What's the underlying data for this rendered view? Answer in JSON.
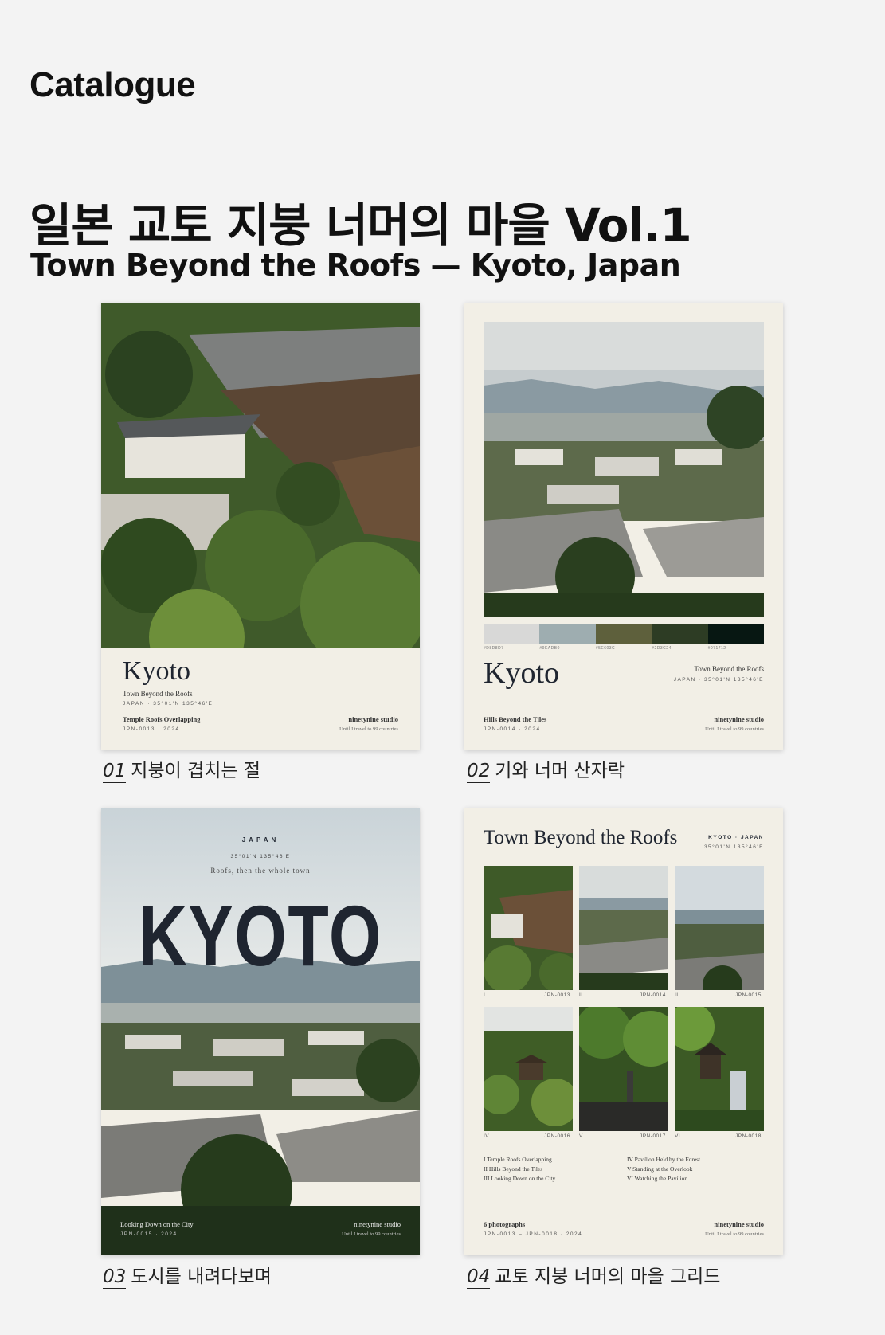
{
  "page_label": "Catalogue",
  "title_ko": "일본 교토 지붕 너머의 마을 Vol.1",
  "title_en": "Town Beyond the Roofs — Kyoto, Japan",
  "captions": [
    {
      "num": "01",
      "text": "지붕이 겹치는 절"
    },
    {
      "num": "02",
      "text": "기와 너머 산자락"
    },
    {
      "num": "03",
      "text": "도시를 내려다보며"
    },
    {
      "num": "04",
      "text": "교토 지붕 너머의 마을 그리드"
    }
  ],
  "card1": {
    "title": "Kyoto",
    "subtitle": "Town Beyond the Roofs",
    "coords": "JAPAN  ·  35°01'N  135°46'E",
    "photo_title": "Temple Roofs Overlapping",
    "code": "JPN-0013  ·  2024",
    "studio": "ninetynine studio",
    "tagline": "Until I travel to 99 countries"
  },
  "card2": {
    "palette": [
      {
        "hex": "#D8D8D7",
        "label": "#D8D8D7"
      },
      {
        "hex": "#9EADB0",
        "label": "#9EADB0"
      },
      {
        "hex": "#5E603C",
        "label": "#5E603C"
      },
      {
        "hex": "#2D3C24",
        "label": "#2D3C24"
      },
      {
        "hex": "#071712",
        "label": "#071712"
      }
    ],
    "title": "Kyoto",
    "subtitle": "Town Beyond the Roofs",
    "coords": "JAPAN  ·  35°01'N  135°46'E",
    "photo_title": "Hills Beyond the Tiles",
    "code": "JPN-0014  ·  2024",
    "studio": "ninetynine studio",
    "tagline": "Until I travel to 99 countries"
  },
  "card3": {
    "country": "JAPAN",
    "coords": "35°01'N  135°46'E",
    "tagline_top": "Roofs, then the whole town",
    "title": "KYOTO",
    "photo_title": "Looking Down on the City",
    "code": "JPN-0015  ·  2024",
    "studio": "ninetynine studio",
    "tagline": "Until I travel to 99 countries"
  },
  "card4": {
    "title": "Town Beyond the Roofs",
    "location": "KYOTO  ·  JAPAN",
    "coords": "35°01'N  135°46'E",
    "cells": [
      {
        "roman": "I",
        "code": "JPN-0013"
      },
      {
        "roman": "II",
        "code": "JPN-0014"
      },
      {
        "roman": "III",
        "code": "JPN-0015"
      },
      {
        "roman": "IV",
        "code": "JPN-0016"
      },
      {
        "roman": "V",
        "code": "JPN-0017"
      },
      {
        "roman": "VI",
        "code": "JPN-0018"
      }
    ],
    "index_left": [
      "I   Temple Roofs Overlapping",
      "II   Hills Beyond the Tiles",
      "III   Looking Down on the City"
    ],
    "index_right": [
      "IV   Pavilion Held by the Forest",
      "V   Standing at the Overlook",
      "VI   Watching the Pavilion"
    ],
    "count": "6 photographs",
    "code": "JPN-0013 – JPN-0018  ·  2024",
    "studio": "ninetynine studio",
    "tagline": "Until I travel to 99 countries"
  }
}
